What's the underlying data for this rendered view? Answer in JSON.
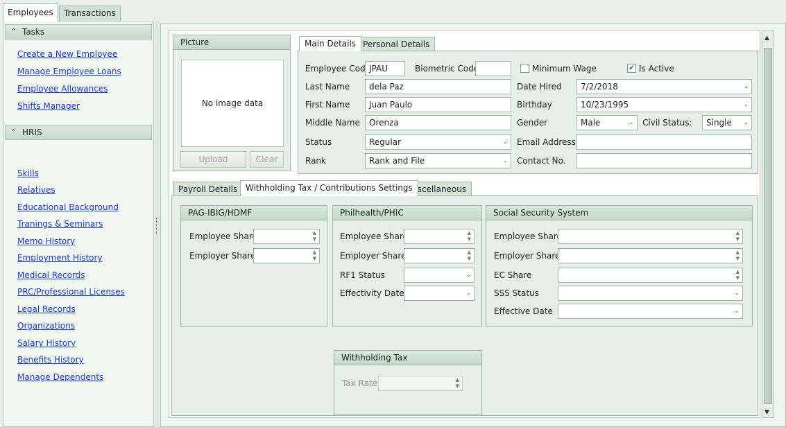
{
  "top_tabs": [
    "Employees",
    "Transactions"
  ],
  "tasks": {
    "header": "Tasks",
    "links": [
      "Create a New Employee",
      "Manage Employee Loans",
      "Employee Allowances",
      "Shifts Manager"
    ]
  },
  "hris": {
    "header": "HRIS",
    "links": [
      "Skills",
      "Relatives",
      "Educational Background",
      "Tranings & Seminars",
      "Memo History",
      "Employment History",
      "Medical Records",
      "PRC/Professional Licenses",
      "Legal Records",
      "Organizations",
      "Salary History",
      "Benefits History",
      "Manage Dependents"
    ]
  },
  "picture": {
    "header": "Picture",
    "empty_text": "No image data",
    "upload_label": "Upload",
    "clear_label": "Clear"
  },
  "details_tabs": [
    "Main Details",
    "Personal Details"
  ],
  "main_details": {
    "employee_code_label": "Employee Code",
    "employee_code": "JPAU",
    "biometric_code_label": "Biometric Code",
    "biometric_code": "",
    "minimum_wage_label": "Minimum Wage",
    "minimum_wage_checked": false,
    "is_active_label": "Is Active",
    "is_active_checked": true,
    "last_name_label": "Last Name",
    "last_name": "dela Paz",
    "first_name_label": "First Name",
    "first_name": "Juan Paulo",
    "middle_name_label": "Middle Name",
    "middle_name": "Orenza",
    "status_label": "Status",
    "status": "Regular",
    "rank_label": "Rank",
    "rank": "Rank and File",
    "date_hired_label": "Date Hired",
    "date_hired": "7/2/2018",
    "birthday_label": "Birthday",
    "birthday": "10/23/1995",
    "gender_label": "Gender",
    "gender": "Male",
    "civil_status_label": "Civil Status:",
    "civil_status": "Single",
    "email_label": "Email Address",
    "email": "",
    "contact_label": "Contact No.",
    "contact": ""
  },
  "settings_tabs": [
    "Payroll Details",
    "Withholding Tax / Contributions Settings",
    "Miscellaneous"
  ],
  "pagibig": {
    "header": "PAG-IBIG/HDMF",
    "employee_share_label": "Employee Share",
    "employer_share_label": "Employer Share"
  },
  "philhealth": {
    "header": "Philhealth/PHIC",
    "employee_share_label": "Employee Share",
    "employer_share_label": "Employer Share",
    "rf1_status_label": "RF1 Status",
    "effectivity_date_label": "Effectivity Date"
  },
  "sss": {
    "header": "Social Security System",
    "employee_share_label": "Employee Share",
    "employer_share_label": "Employer Share",
    "ec_share_label": "EC Share",
    "sss_status_label": "SSS Status",
    "effective_date_label": "Effective Date"
  },
  "withholding": {
    "header": "Withholding Tax",
    "tax_rate_label": "Tax Rate"
  },
  "icons": {
    "collapse": "chevron-up-double-icon",
    "dropdown": "chevron-down-icon",
    "spinner": "spinner-arrows-icon",
    "checkbox": "checkmark-icon"
  }
}
